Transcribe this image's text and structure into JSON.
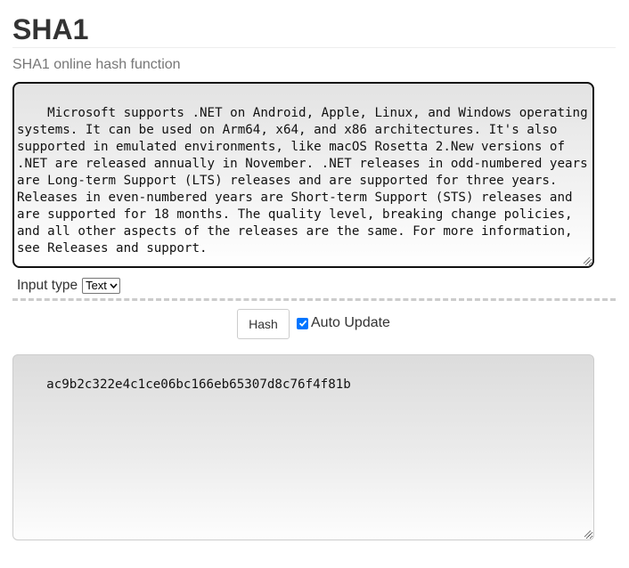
{
  "header": {
    "title": "SHA1",
    "subtitle": "SHA1 online hash function"
  },
  "input": {
    "text": "Microsoft supports .NET on Android, Apple, Linux, and Windows operating systems. It can be used on Arm64, x64, and x86 architectures. It's also supported in emulated environments, like macOS Rosetta 2.New versions of .NET are released annually in November. .NET releases in odd-numbered years are Long-term Support (LTS) releases and are supported for three years. Releases in even-numbered years are Short-term Support (STS) releases and are supported for 18 months. The quality level, breaking change policies, and all other aspects of the releases are the same. For more information, see Releases and support."
  },
  "input_type": {
    "label": "Input type",
    "selected": "Text"
  },
  "controls": {
    "hash_label": "Hash",
    "auto_update_label": "Auto Update",
    "auto_update_checked": true
  },
  "output": {
    "text": "ac9b2c322e4c1ce06bc166eb65307d8c76f4f81b"
  },
  "colors": {
    "checkbox_accent": "#0075ff",
    "title": "#333333",
    "subtitle": "#777777"
  }
}
